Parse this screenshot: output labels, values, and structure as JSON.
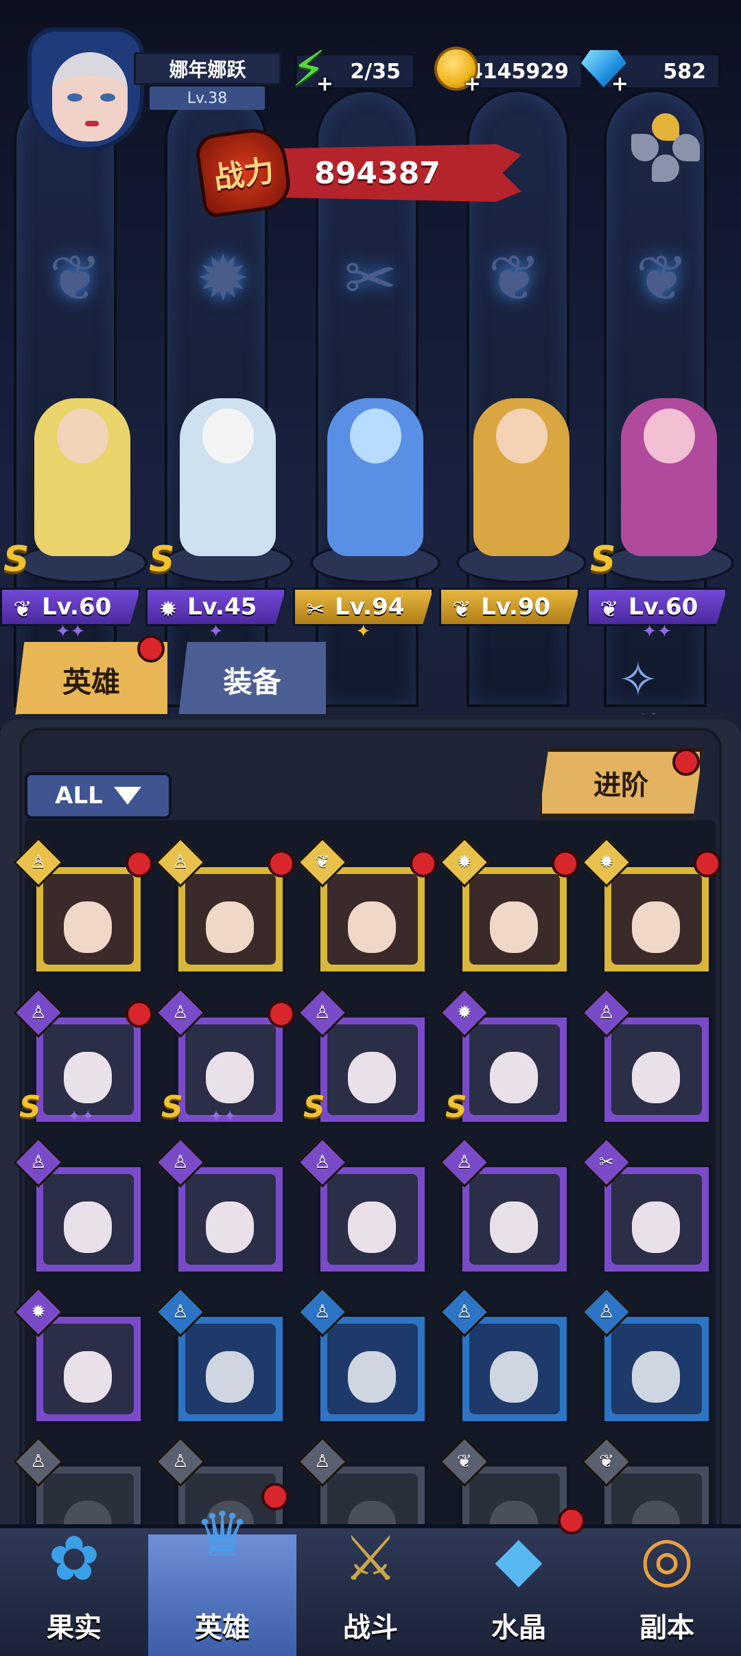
{
  "player": {
    "name": "娜年娜跃",
    "level": "Lv.38"
  },
  "resources": {
    "energy": "2/35",
    "coins": "4145929",
    "gems": "582"
  },
  "power": {
    "label": "战力",
    "value": "894387"
  },
  "team": [
    {
      "level": "Lv.60",
      "rank": "S",
      "stars": "✦✦",
      "tag_color": "purple",
      "class_icon": "wing-icon"
    },
    {
      "level": "Lv.45",
      "rank": "S",
      "stars": "✦",
      "tag_color": "purple",
      "class_icon": "beast-icon"
    },
    {
      "level": "Lv.94",
      "rank": "",
      "stars": "✦",
      "tag_color": "gold",
      "class_icon": "wrench-icon"
    },
    {
      "level": "Lv.90",
      "rank": "",
      "stars": "",
      "tag_color": "gold",
      "class_icon": "wing-icon"
    },
    {
      "level": "Lv.60",
      "rank": "S",
      "stars": "✦✦",
      "tag_color": "purple",
      "class_icon": "wing-icon"
    }
  ],
  "tabs": {
    "heroes": "英雄",
    "equipment": "装备"
  },
  "bond_label": "羁绊",
  "filter_label": "ALL",
  "advance_label": "进阶",
  "roster": [
    [
      {
        "color": "gold",
        "badge": "gold",
        "icon": "potion-icon",
        "dot": true,
        "s": false
      },
      {
        "color": "gold",
        "badge": "gold",
        "icon": "potion-icon",
        "dot": true,
        "s": false
      },
      {
        "color": "gold",
        "badge": "gold",
        "icon": "wing-icon",
        "dot": true,
        "s": false
      },
      {
        "color": "gold",
        "badge": "gold",
        "icon": "beast-icon",
        "dot": true,
        "s": false
      },
      {
        "color": "gold",
        "badge": "gold",
        "icon": "beast-icon",
        "dot": true,
        "s": false
      }
    ],
    [
      {
        "color": "purple",
        "badge": "purple",
        "icon": "potion-icon",
        "dot": true,
        "s": true,
        "stars": "✦✦"
      },
      {
        "color": "purple",
        "badge": "purple",
        "icon": "potion-icon",
        "dot": true,
        "s": true,
        "stars": "✦✦"
      },
      {
        "color": "purple",
        "badge": "purple",
        "icon": "potion-icon",
        "dot": false,
        "s": true
      },
      {
        "color": "purple",
        "badge": "purple",
        "icon": "beast-icon",
        "dot": false,
        "s": true
      },
      {
        "color": "purple",
        "badge": "purple",
        "icon": "potion-icon",
        "dot": false,
        "s": false
      }
    ],
    [
      {
        "color": "purple",
        "badge": "purple",
        "icon": "potion-icon",
        "dot": false,
        "s": false
      },
      {
        "color": "purple",
        "badge": "purple",
        "icon": "potion-icon",
        "dot": false,
        "s": false
      },
      {
        "color": "purple",
        "badge": "purple",
        "icon": "potion-icon",
        "dot": false,
        "s": false
      },
      {
        "color": "purple",
        "badge": "purple",
        "icon": "potion-icon",
        "dot": false,
        "s": false
      },
      {
        "color": "purple",
        "badge": "purple",
        "icon": "wrench-icon",
        "dot": false,
        "s": false
      }
    ],
    [
      {
        "color": "purple",
        "badge": "purple",
        "icon": "beast-icon",
        "dot": false,
        "s": false
      },
      {
        "color": "blue",
        "badge": "blue",
        "icon": "potion-icon",
        "dot": false,
        "s": false
      },
      {
        "color": "blue",
        "badge": "blue",
        "icon": "potion-icon",
        "dot": false,
        "s": false
      },
      {
        "color": "blue",
        "badge": "blue",
        "icon": "potion-icon",
        "dot": false,
        "s": false
      },
      {
        "color": "blue",
        "badge": "blue",
        "icon": "potion-icon",
        "dot": false,
        "s": false
      }
    ],
    [
      {
        "color": "grey",
        "badge": "grey",
        "icon": "potion-icon",
        "dot": false,
        "s": false
      },
      {
        "color": "grey",
        "badge": "grey",
        "icon": "potion-icon",
        "dot": false,
        "s": false
      },
      {
        "color": "grey",
        "badge": "grey",
        "icon": "potion-icon",
        "dot": false,
        "s": false
      },
      {
        "color": "grey",
        "badge": "grey",
        "icon": "wing-icon",
        "dot": false,
        "s": false
      },
      {
        "color": "grey",
        "badge": "grey",
        "icon": "wing-icon",
        "dot": false,
        "s": false
      }
    ]
  ],
  "nav": [
    {
      "label": "果实",
      "icon": "fruit-icon",
      "active": false,
      "dot": false
    },
    {
      "label": "英雄",
      "icon": "hero-hat-icon",
      "active": true,
      "dot": true
    },
    {
      "label": "战斗",
      "icon": "sword-icon",
      "active": false,
      "dot": false
    },
    {
      "label": "水晶",
      "icon": "crystal-icon",
      "active": false,
      "dot": true
    },
    {
      "label": "副本",
      "icon": "portal-icon",
      "active": false,
      "dot": false
    }
  ],
  "colors": {
    "gold_frame": "#d8b73a",
    "purple_frame": "#7a4bc9",
    "blue_frame": "#2e74c4",
    "grey_frame": "#454c5e",
    "red_dot": "#d9262d",
    "power_banner": "#b5232b"
  }
}
